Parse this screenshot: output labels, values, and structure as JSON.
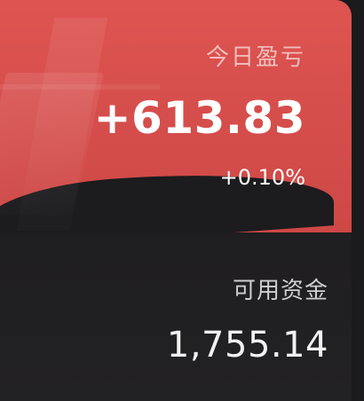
{
  "pnl_card": {
    "label": "今日盈亏",
    "value": "+613.83",
    "rate": "+0.10%",
    "accent_color": "#d94f4c"
  },
  "cash": {
    "label": "可用资金",
    "value": "1,755.14"
  }
}
